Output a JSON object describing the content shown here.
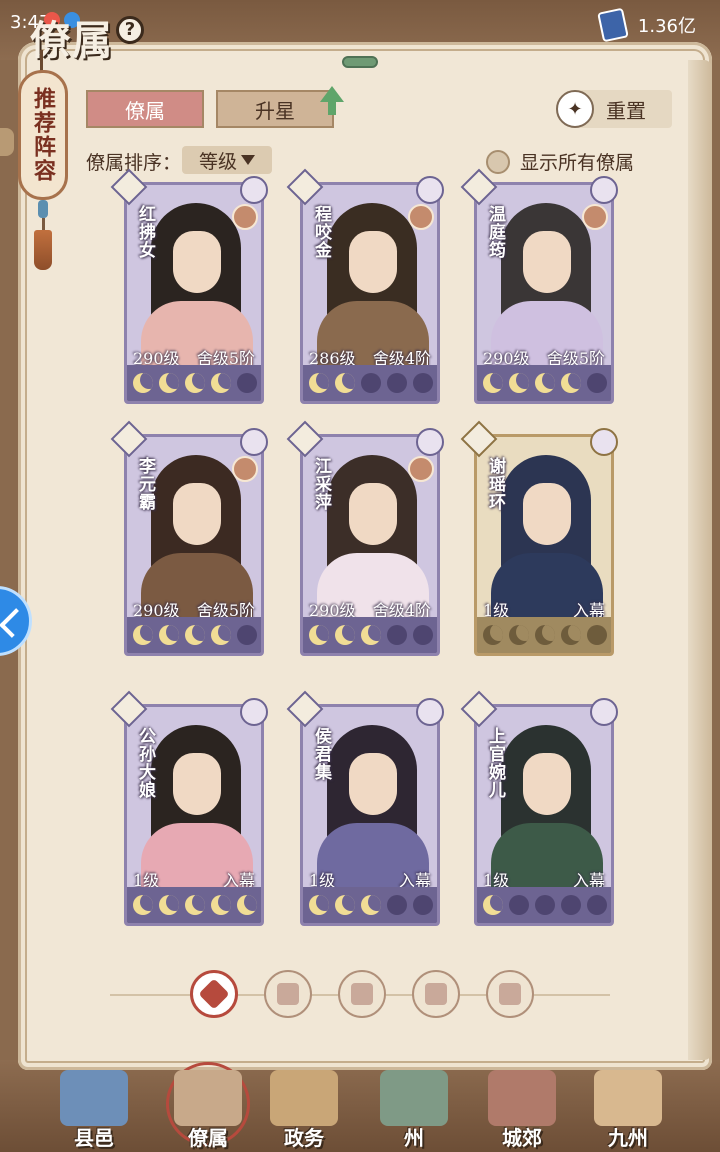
{
  "status": {
    "time": "3:47",
    "currency": "1.36亿"
  },
  "header": {
    "title": "僚属",
    "help": "?"
  },
  "recommend_tag": "推荐阵容",
  "tabs": [
    {
      "label": "僚属",
      "active": true
    },
    {
      "label": "升星",
      "active": false
    }
  ],
  "reset_label": "重置",
  "sort": {
    "label": "僚属排序：",
    "value": "等级"
  },
  "show_all_label": "显示所有僚属",
  "cards": [
    {
      "name": "红拂女",
      "level": "290级",
      "rank": "舍级5阶",
      "moons": 4,
      "frame": "purple",
      "hair": "#2b2420",
      "body": "#e7b5ae",
      "partner": true
    },
    {
      "name": "程咬金",
      "level": "286级",
      "rank": "舍级4阶",
      "moons": 2,
      "frame": "purple",
      "hair": "#3a2d22",
      "body": "#8a6a4e",
      "partner": true
    },
    {
      "name": "温庭筠",
      "level": "290级",
      "rank": "舍级5阶",
      "moons": 4,
      "frame": "purple",
      "hair": "#3a3636",
      "body": "#cfc0e0",
      "partner": true
    },
    {
      "name": "李元霸",
      "level": "290级",
      "rank": "舍级5阶",
      "moons": 4,
      "frame": "purple",
      "hair": "#3c2a22",
      "body": "#7b5a42",
      "partner": true
    },
    {
      "name": "江采萍",
      "level": "290级",
      "rank": "舍级4阶",
      "moons": 3,
      "frame": "purple",
      "hair": "#3c2e28",
      "body": "#f0e2ea",
      "partner": true
    },
    {
      "name": "谢瑶环",
      "level": "1级",
      "rank": "入幕",
      "moons": 4,
      "frame": "gold",
      "hair": "#2c3552",
      "body": "#2d3a5c",
      "partner": false
    },
    {
      "name": "公孙大娘",
      "level": "1级",
      "rank": "入幕",
      "moons": 5,
      "frame": "purple",
      "hair": "#2b2420",
      "body": "#e7a9b3",
      "partner": false
    },
    {
      "name": "侯君集",
      "level": "1级",
      "rank": "入幕",
      "moons": 3,
      "frame": "purple",
      "hair": "#2e2632",
      "body": "#6f6aa0",
      "partner": false
    },
    {
      "name": "上官婉儿",
      "level": "1级",
      "rank": "入幕",
      "moons": 1,
      "frame": "purple",
      "hair": "#2b3230",
      "body": "#3d5a48",
      "partner": false
    }
  ],
  "filters": [
    "all",
    "faction-1",
    "faction-2",
    "faction-3",
    "faction-4"
  ],
  "nav": [
    {
      "label": "县邑",
      "active": false,
      "color": "#6d8fb8"
    },
    {
      "label": "僚属",
      "active": true,
      "color": "#c8a98a"
    },
    {
      "label": "政务",
      "active": false,
      "color": "#c9a677"
    },
    {
      "label": "州",
      "active": false,
      "color": "#7f9a86"
    },
    {
      "label": "城郊",
      "active": false,
      "color": "#b07a6a"
    },
    {
      "label": "九州",
      "active": false,
      "color": "#d8b88f"
    }
  ]
}
